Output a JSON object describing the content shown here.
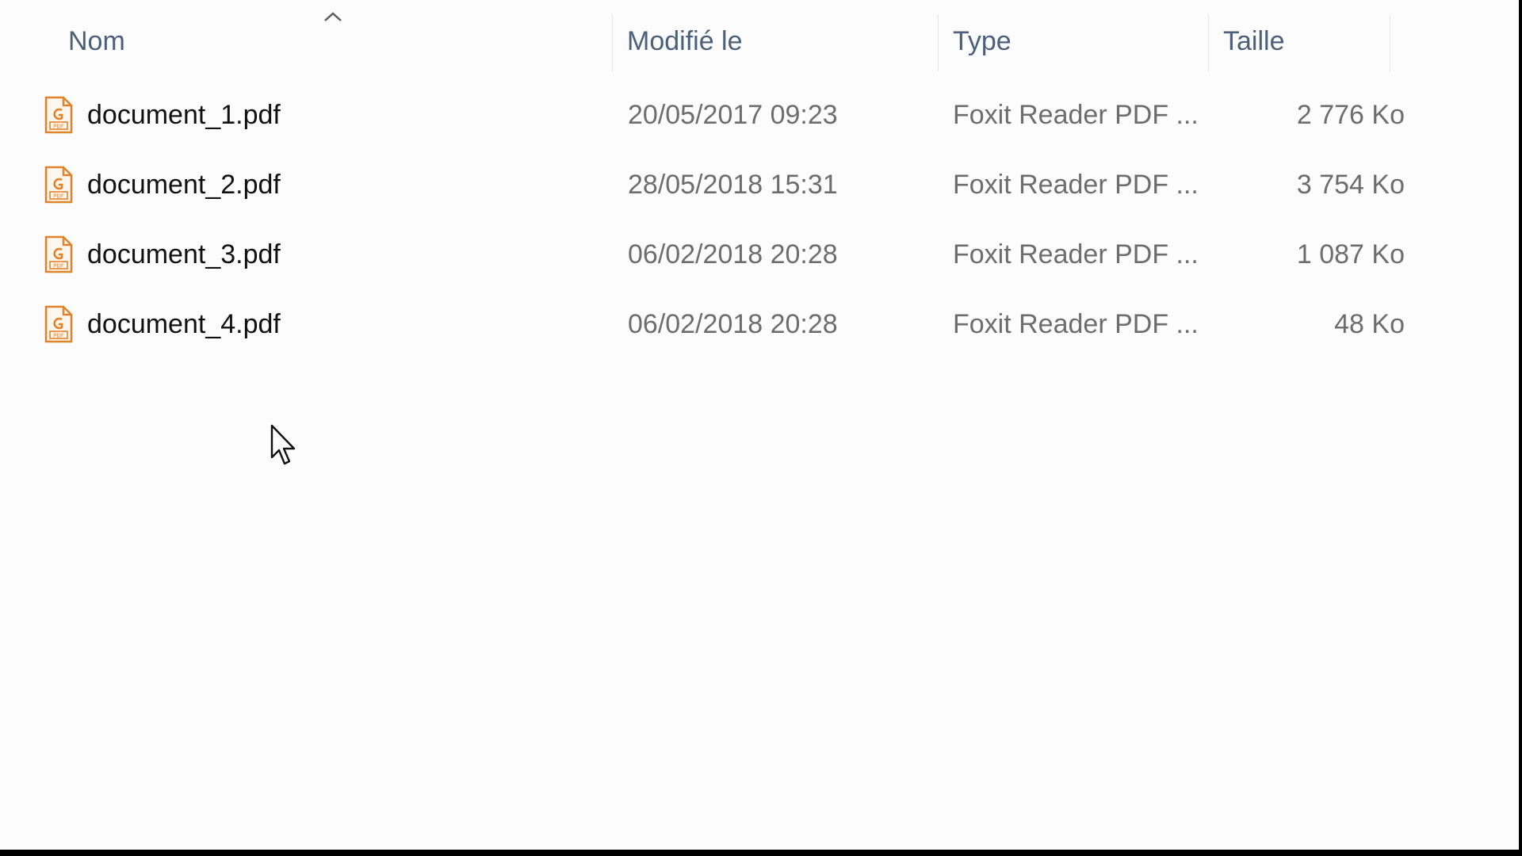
{
  "columns": {
    "name": "Nom",
    "modified": "Modifié le",
    "type": "Type",
    "size": "Taille"
  },
  "sort": {
    "column": "name",
    "direction": "ascending",
    "icon": "chevron-up-icon"
  },
  "files": [
    {
      "name": "document_1.pdf",
      "modified": "20/05/2017 09:23",
      "type": "Foxit Reader PDF ...",
      "size": "2 776 Ko",
      "icon": "pdf-file-icon"
    },
    {
      "name": "document_2.pdf",
      "modified": "28/05/2018 15:31",
      "type": "Foxit Reader PDF ...",
      "size": "3 754 Ko",
      "icon": "pdf-file-icon"
    },
    {
      "name": "document_3.pdf",
      "modified": "06/02/2018 20:28",
      "type": "Foxit Reader PDF ...",
      "size": "1 087 Ko",
      "icon": "pdf-file-icon"
    },
    {
      "name": "document_4.pdf",
      "modified": "06/02/2018 20:28",
      "type": "Foxit Reader PDF ...",
      "size": "48 Ko",
      "icon": "pdf-file-icon"
    }
  ],
  "colors": {
    "background": "#fcfcfc",
    "header_text": "#4c607a",
    "name_text": "#111111",
    "meta_text": "#6d6d6d",
    "pdf_icon_accent": "#e0822b"
  }
}
